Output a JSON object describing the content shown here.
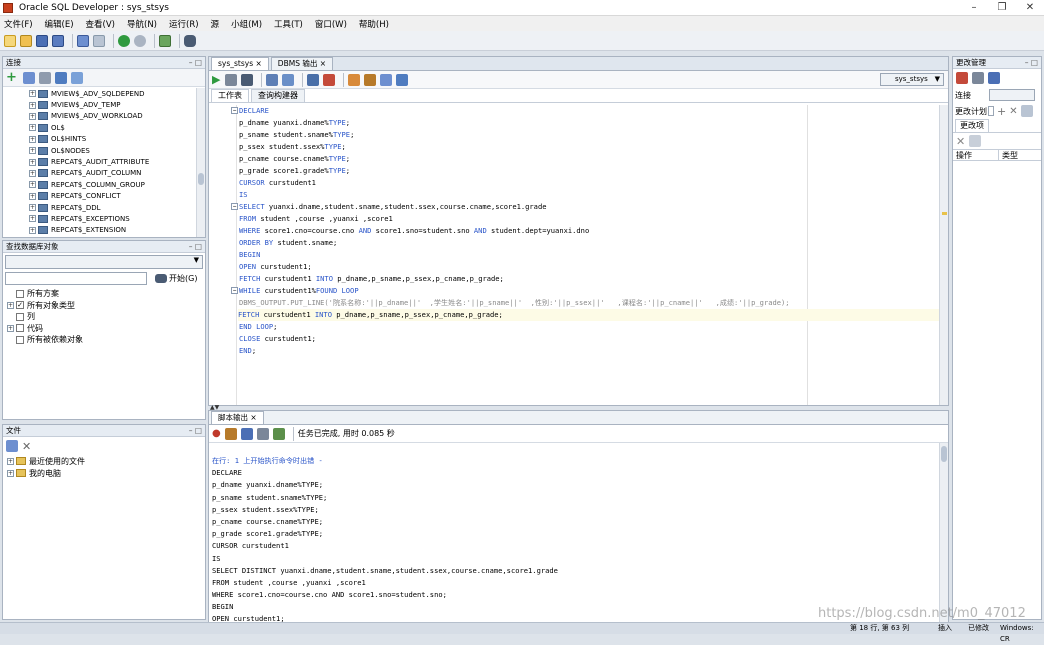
{
  "window": {
    "title": "Oracle SQL Developer : sys_stsys"
  },
  "menu": [
    "文件(F)",
    "编辑(E)",
    "查看(V)",
    "导航(N)",
    "运行(R)",
    "源",
    "小组(M)",
    "工具(T)",
    "窗口(W)",
    "帮助(H)"
  ],
  "connections_panel": {
    "title": "连接",
    "items": [
      "MVIEW$_ADV_SQLDEPEND",
      "MVIEW$_ADV_TEMP",
      "MVIEW$_ADV_WORKLOAD",
      "OL$",
      "OL$HINTS",
      "OL$NODES",
      "REPCAT$_AUDIT_ATTRIBUTE",
      "REPCAT$_AUDIT_COLUMN",
      "REPCAT$_COLUMN_GROUP",
      "REPCAT$_CONFLICT",
      "REPCAT$_DDL",
      "REPCAT$_EXCEPTIONS",
      "REPCAT$_EXTENSION"
    ]
  },
  "find_panel": {
    "title": "查找数据库对象",
    "start_label": "开始(G)",
    "items": [
      {
        "label": "所有方案",
        "checked": false,
        "expand": false
      },
      {
        "label": "所有对象类型",
        "checked": true,
        "expand": true
      },
      {
        "label": "列",
        "checked": false,
        "expand": false
      },
      {
        "label": "代码",
        "checked": false,
        "expand": true
      },
      {
        "label": "所有被依赖对象",
        "checked": false,
        "expand": false
      }
    ]
  },
  "files_panel": {
    "title": "文件",
    "items": [
      "最近使用的文件",
      "我的电脑"
    ]
  },
  "editor": {
    "tabs": [
      "sys_stsys",
      "DBMS 输出"
    ],
    "connection": "sys_stsys",
    "subtabs": [
      "工作表",
      "查询构建器"
    ],
    "lines": [
      [
        {
          "t": "DECLARE",
          "c": "kw"
        }
      ],
      [
        {
          "t": "p_dname yuanxi.dname%"
        },
        {
          "t": "TYPE",
          "c": "kw"
        },
        {
          "t": ";"
        }
      ],
      [
        {
          "t": "p_sname student.sname%"
        },
        {
          "t": "TYPE",
          "c": "kw"
        },
        {
          "t": ";"
        }
      ],
      [
        {
          "t": "p_ssex student.ssex%"
        },
        {
          "t": "TYPE",
          "c": "kw"
        },
        {
          "t": ";"
        }
      ],
      [
        {
          "t": "p_cname course.cname%"
        },
        {
          "t": "TYPE",
          "c": "kw"
        },
        {
          "t": ";"
        }
      ],
      [
        {
          "t": "p_grade score1.grade%"
        },
        {
          "t": "TYPE",
          "c": "kw"
        },
        {
          "t": ";"
        }
      ],
      [
        {
          "t": "CURSOR",
          "c": "kw"
        },
        {
          "t": " curstudent1"
        }
      ],
      [
        {
          "t": "IS",
          "c": "kw"
        }
      ],
      [
        {
          "t": "SELECT",
          "c": "kw"
        },
        {
          "t": " yuanxi.dname,student.sname,student.ssex,course.cname,score1.grade"
        }
      ],
      [
        {
          "t": "FROM",
          "c": "kw"
        },
        {
          "t": " student ,course ,yuanxi ,score1"
        }
      ],
      [
        {
          "t": "WHERE",
          "c": "kw"
        },
        {
          "t": " score1.cno=course.cno "
        },
        {
          "t": "AND",
          "c": "kw"
        },
        {
          "t": " score1.sno=student.sno "
        },
        {
          "t": "AND",
          "c": "kw"
        },
        {
          "t": " student.dept=yuanxi.dno"
        }
      ],
      [
        {
          "t": "ORDER BY",
          "c": "kw"
        },
        {
          "t": " student.sname;"
        }
      ],
      [
        {
          "t": "BEGIN",
          "c": "kw"
        }
      ],
      [
        {
          "t": "OPEN",
          "c": "kw"
        },
        {
          "t": " curstudent1;"
        }
      ],
      [
        {
          "t": "FETCH",
          "c": "kw"
        },
        {
          "t": " curstudent1 "
        },
        {
          "t": "INTO",
          "c": "kw"
        },
        {
          "t": " p_dname,p_sname,p_ssex,p_cname,p_grade;"
        }
      ],
      [
        {
          "t": "WHILE",
          "c": "kw"
        },
        {
          "t": " curstudent1%"
        },
        {
          "t": "FOUND LOOP",
          "c": "kw"
        }
      ],
      [
        {
          "t": "DBMS_OUTPUT.PUT_LINE('院系名称:'||p_dname||'  ,学生姓名:'||p_sname||'  ,性别:'||p_ssex||'   ,课程名:'||p_cname||'   ,成绩:'||p_grade);",
          "c": "cm"
        }
      ],
      [
        {
          "t": "FETCH",
          "c": "kw"
        },
        {
          "t": " curstudent1 "
        },
        {
          "t": "INTO",
          "c": "kw"
        },
        {
          "t": " p_dname,p_sname,p_ssex,p_cname,p_grade;"
        }
      ],
      [
        {
          "t": "END LOOP",
          "c": "kw"
        },
        {
          "t": ";"
        }
      ],
      [
        {
          "t": "CLOSE",
          "c": "kw"
        },
        {
          "t": " curstudent1;"
        }
      ],
      [
        {
          "t": "END",
          "c": "kw"
        },
        {
          "t": ";"
        }
      ]
    ]
  },
  "output": {
    "tab": "脚本输出",
    "status": "任务已完成, 用时 0.085 秒",
    "header": "在行: 1 上开始执行命令时出错 -",
    "lines": [
      "DECLARE",
      "p_dname yuanxi.dname%TYPE;",
      "p_sname student.sname%TYPE;",
      "p_ssex student.ssex%TYPE;",
      "p_cname course.cname%TYPE;",
      "p_grade score1.grade%TYPE;",
      "CURSOR curstudent1",
      "IS",
      "SELECT DISTINCT yuanxi.dname,student.sname,student.ssex,course.cname,score1.grade",
      "FROM student ,course ,yuanxi ,score1",
      "WHERE score1.cno=course.cno AND score1.sno=student.sno;",
      "BEGIN",
      "OPEN curstudent1;"
    ]
  },
  "changes_panel": {
    "title": "更改管理",
    "conn_label": "连接",
    "plan_label": "更改计划",
    "items_tab": "更改项",
    "col_op": "操作",
    "col_type": "类型"
  },
  "statusbar": {
    "pos": "第 18 行, 第 63 列",
    "mode": "插入",
    "modified": "已修改",
    "os": "Windows: CR"
  },
  "watermark": "https://blog.csdn.net/m0_47012"
}
